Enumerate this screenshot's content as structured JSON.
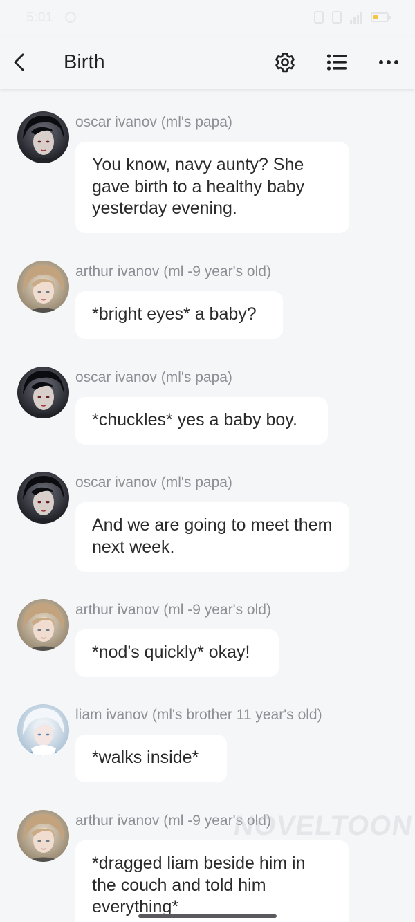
{
  "status_bar": {
    "time": "5:01",
    "icons": [
      "alarm-icon",
      "vibrate-icon",
      "hd-icon",
      "signal-icon",
      "battery-icon"
    ]
  },
  "header": {
    "title": "Birth",
    "back_icon": "chevron-left-icon",
    "settings_icon": "gear-icon",
    "list_icon": "list-icon",
    "more_icon": "more-dots-icon"
  },
  "messages": [
    {
      "sender": "oscar ivanov (ml's papa)",
      "avatar": "dark-haired-man-avatar",
      "text": "You know, navy aunty? She gave birth to a healthy baby yesterday evening."
    },
    {
      "sender": "arthur ivanov (ml -9 year's old)",
      "avatar": "blonde-boy-avatar",
      "text": "*bright eyes* a baby?"
    },
    {
      "sender": "oscar ivanov (ml's papa)",
      "avatar": "dark-haired-man-avatar",
      "text": "*chuckles* yes a baby boy."
    },
    {
      "sender": "oscar ivanov (ml's papa)",
      "avatar": "dark-haired-man-avatar",
      "text": "And we are going to meet them next week."
    },
    {
      "sender": "arthur ivanov (ml -9 year's old)",
      "avatar": "blonde-boy-avatar",
      "text": "*nod's quickly* okay!"
    },
    {
      "sender": "liam ivanov (ml's brother 11 year's old)",
      "avatar": "white-haired-boy-avatar",
      "text": "*walks inside*"
    },
    {
      "sender": "arthur ivanov (ml -9 year's old)",
      "avatar": "blonde-boy-avatar",
      "text": "*dragged liam beside him in the couch and told him everything*"
    }
  ],
  "watermark": "NOVELTOON",
  "colors": {
    "background": "#f5f6f8",
    "bubble": "#ffffff",
    "sender_text": "#8e8e95",
    "message_text": "#2a2a2a"
  }
}
